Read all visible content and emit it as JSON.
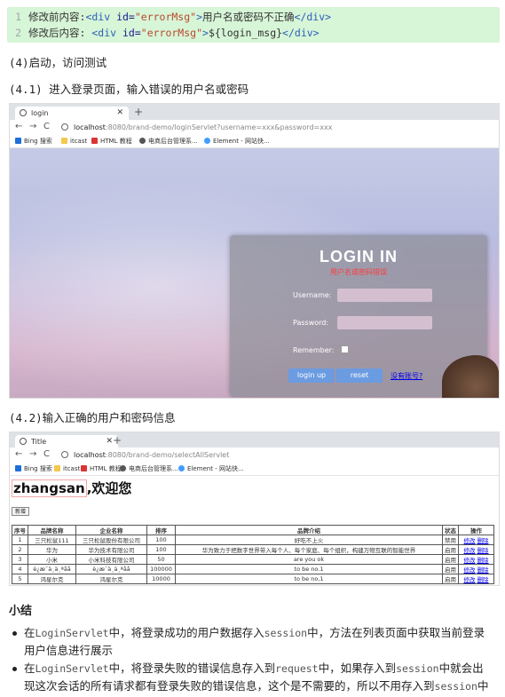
{
  "code_block": {
    "lines": [
      {
        "num": "1",
        "prefix": "修改前内容:",
        "tag_open": "<div ",
        "attr": "id=",
        "value": "\"errorMsg\"",
        "tag_close": ">",
        "content": "用户名或密码不正确",
        "end_tag": "</div>"
      },
      {
        "num": "2",
        "prefix": "修改后内容: ",
        "tag_open": "<div ",
        "attr": "id=",
        "value": "\"errorMsg\"",
        "tag_close": ">",
        "content": "${login_msg}",
        "end_tag": "</div>"
      }
    ]
  },
  "step4": "(4)启动，访问测试",
  "step4_1": "(4.1) 进入登录页面，输入错误的用户名或密码",
  "step4_2": "(4.2)输入正确的用户和密码信息",
  "browser1": {
    "tab_title": "login",
    "url_host": "localhost",
    "url_path": ":8080/brand-demo/loginServlet?username=xxx&password=xxx",
    "bookmarks": [
      "Bing 搜索",
      "itcast",
      "HTML 教程",
      "电商后台管理系...",
      "Element - 网站快..."
    ],
    "login": {
      "title": "LOGIN IN",
      "error": "用户名或密码错误",
      "username_label": "Username:",
      "password_label": "Password:",
      "remember_label": "Remember:",
      "login_button": "login up",
      "reset_button": "reset",
      "register_link": "没有账号?"
    }
  },
  "browser2": {
    "tab_title": "Title",
    "url_host": "localhost",
    "url_path": ":8080/brand-demo/selectAllServlet",
    "bookmarks": [
      "Bing 搜索",
      "itcast",
      "HTML 教程",
      "电商后台管理系...",
      "Element - 网站快..."
    ],
    "username": "zhangsan",
    "welcome_suffix": ",欢迎您",
    "add_button": "新增",
    "table": {
      "headers": [
        "序号",
        "品牌名称",
        "企业名称",
        "排序",
        "品牌介绍",
        "状态",
        "操作"
      ],
      "rows": [
        [
          "1",
          "三只松鼠111",
          "三只松鼠股份有限公司",
          "100",
          "好吃不上火",
          "禁用"
        ],
        [
          "2",
          "华为",
          "华为技术有限公司",
          "100",
          "华为致力于把数字世界带入每个人、每个家庭、每个组织，构建万物互联的智能世界",
          "启用"
        ],
        [
          "3",
          "小米",
          "小米科技有限公司",
          "50",
          "are you ok",
          "启用"
        ],
        [
          "4",
          "è¿æ¯ä¸ä¸ªåå",
          "è¿æ¯ä¸ä¸ªåå",
          "100000",
          "to be no.1",
          "启用"
        ],
        [
          "5",
          "鸿星尔克",
          "鸿星尔克",
          "10000",
          "to be no,1",
          "启用"
        ]
      ],
      "edit_label": "修改",
      "delete_label": "删除"
    }
  },
  "summary_title": "小结",
  "bullets": [
    {
      "lines": [
        [
          {
            "t": "在"
          },
          {
            "c": "LoginServlet"
          },
          {
            "t": "中，将登录成功的用户数据存入"
          },
          {
            "c": "session"
          },
          {
            "t": "中，方法在列表页面中获取当前登录"
          }
        ],
        [
          {
            "t": "用户信息进行展示"
          }
        ]
      ]
    },
    {
      "lines": [
        [
          {
            "t": "在"
          },
          {
            "c": "LoginServlet"
          },
          {
            "t": "中，将登录失败的错误信息存入到"
          },
          {
            "c": "request"
          },
          {
            "t": "中，如果存入到"
          },
          {
            "c": "session"
          },
          {
            "t": "中就会出"
          }
        ],
        [
          {
            "t": "现这次会话的所有请求都有登录失败的错误信息，这个是不需要的，所以不用存入到"
          },
          {
            "c": "session"
          },
          {
            "t": "中"
          }
        ]
      ]
    }
  ]
}
